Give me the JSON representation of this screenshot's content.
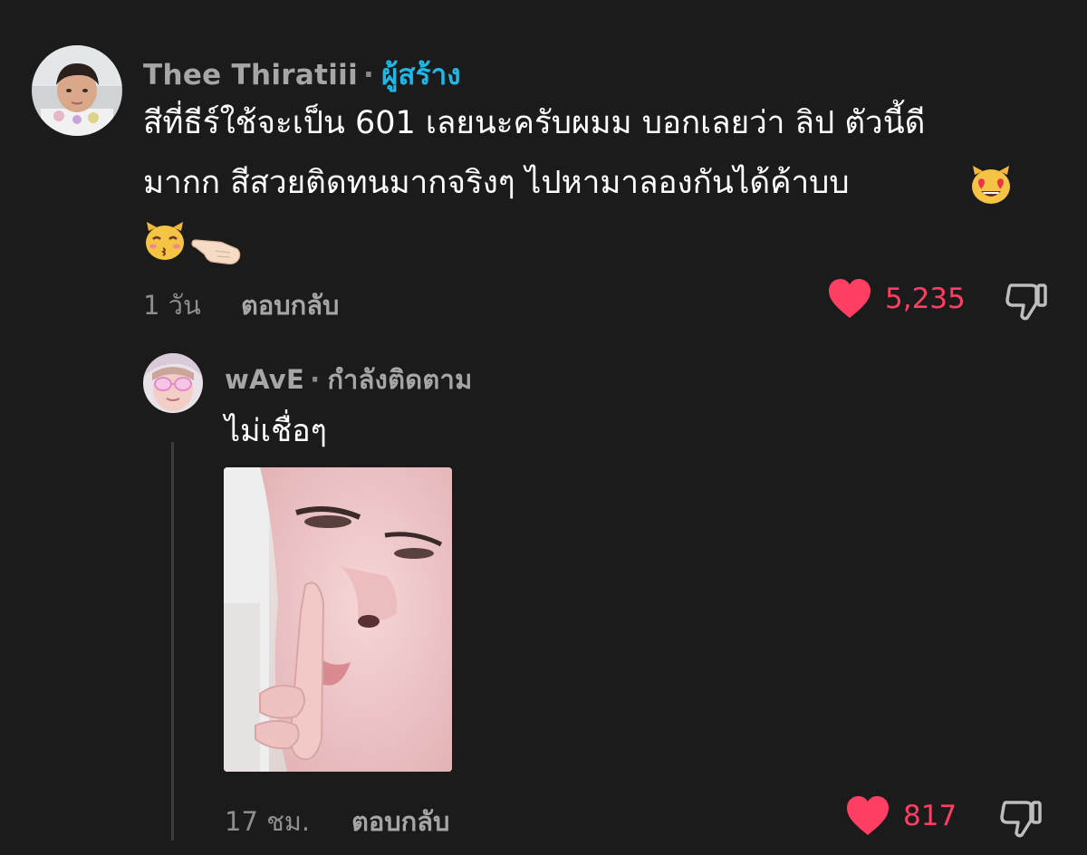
{
  "comment": {
    "author": "Thee Thiratiii",
    "separator": "·",
    "role": "ผู้สร้าง",
    "lines": [
      "สีที่ธีร์ใช้จะเป็น 601 เลยนะครับผมม บอกเลยว่า ลิป ตัวนี้ดี",
      "มากก สีสวยติดทนมากจริงๆ ไปหามาลองกันได้ค้าบบ"
    ],
    "emojis": [
      "heart-eyes-cat-emoji",
      "kissing-cat-emoji",
      "pointing-hand-emoji"
    ],
    "time": "1 วัน",
    "reply_label": "ตอบกลับ",
    "likes": "5,235"
  },
  "reply": {
    "author": "wAvE",
    "separator": "·",
    "role": "กำลังติดตาม",
    "text": "ไม่เชื่อๆ",
    "time": "17 ชม.",
    "reply_label": "ตอบกลับ",
    "likes": "817"
  },
  "colors": {
    "background": "#1b1b1b",
    "creator_badge": "#1fb8e6",
    "like_red": "#ff3e63",
    "muted": "#a6a6a6"
  }
}
